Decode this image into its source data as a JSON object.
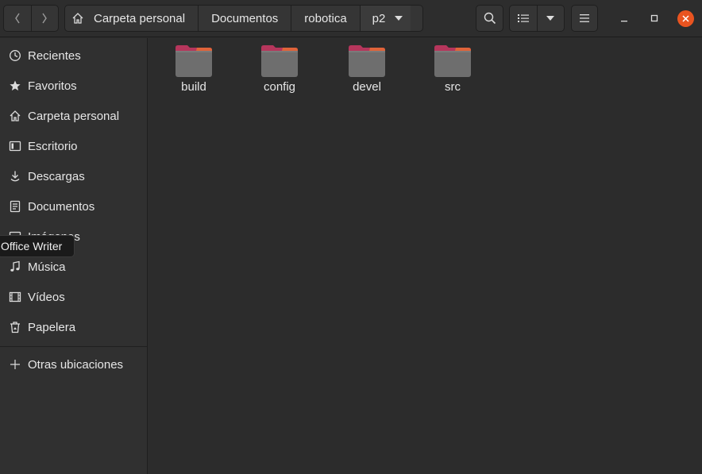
{
  "nav": {
    "back_icon": "chevron-left-icon",
    "forward_icon": "chevron-right-icon"
  },
  "path": {
    "home_icon": "home-icon",
    "crumbs": [
      "Carpeta personal",
      "Documentos",
      "robotica",
      "p2"
    ]
  },
  "toolbar": {
    "search_icon": "search-icon",
    "view_icon": "list-view-icon",
    "view_options_icon": "triangle-down-icon",
    "menu_icon": "hamburger-icon"
  },
  "window": {
    "minimize_icon": "minimize-icon",
    "maximize_icon": "maximize-icon",
    "close_icon": "close-icon",
    "close_color": "#e95420"
  },
  "sidebar": {
    "items": [
      {
        "label": "Recientes",
        "icon": "clock-icon"
      },
      {
        "label": "Favoritos",
        "icon": "star-icon"
      },
      {
        "label": "Carpeta personal",
        "icon": "home-icon"
      },
      {
        "label": "Escritorio",
        "icon": "desktop-icon"
      },
      {
        "label": "Descargas",
        "icon": "download-icon"
      },
      {
        "label": "Documentos",
        "icon": "document-icon"
      },
      {
        "label": "Imágenes",
        "icon": "image-icon"
      },
      {
        "label": "Música",
        "icon": "music-icon"
      },
      {
        "label": "Vídeos",
        "icon": "video-icon"
      },
      {
        "label": "Papelera",
        "icon": "trash-icon"
      }
    ],
    "other": {
      "label": "Otras ubicaciones",
      "icon": "plus-icon"
    }
  },
  "tooltip": {
    "text": "Office Writer"
  },
  "files": [
    {
      "name": "build",
      "icon": "folder-icon"
    },
    {
      "name": "config",
      "icon": "folder-icon"
    },
    {
      "name": "devel",
      "icon": "folder-icon"
    },
    {
      "name": "src",
      "icon": "folder-icon"
    }
  ],
  "colors": {
    "folder_tab": "#b6365c",
    "folder_tab_accent": "#e0643a",
    "folder_body": "#6e6e6e",
    "accent": "#e95420"
  }
}
